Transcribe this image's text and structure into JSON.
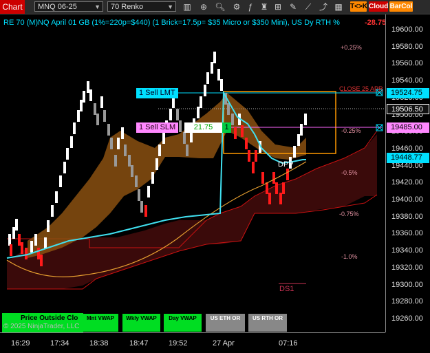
{
  "toolbar": {
    "chart_label": "Chart",
    "instrument": "MNQ 06-25",
    "bartype": "70 Renko",
    "tk_label": "T<>K",
    "cloud_label": "Cloud",
    "barcol_label": "BarCol"
  },
  "chart": {
    "title": "RE 70 (M)NQ April 01 GB (1%=220p=$440) (1 Brick=17.5p= $35 Micro or $350 Mini), US Dy RTH %",
    "pnl": "-28.75",
    "close_label": "CLOSE 25 APR",
    "dpp_label": "DPP",
    "ds1_label": "DS1",
    "watermark_line1": "Price Outside Clo",
    "watermark_line2": "© 2025 NinjaTrader, LLC"
  },
  "percent_levels": [
    "+0.25%",
    "-0.25%",
    "-0.5%",
    "-0.75%",
    "-1.0%"
  ],
  "y_axis": [
    "19600.00",
    "19580.00",
    "19560.00",
    "19540.00",
    "19520.00",
    "19500.00",
    "19480.00",
    "19460.00",
    "19440.00",
    "19420.00",
    "19400.00",
    "19380.00",
    "19360.00",
    "19340.00",
    "19320.00",
    "19300.00",
    "19280.00",
    "19260.00"
  ],
  "x_axis": [
    "16:29",
    "17:34",
    "18:38",
    "18:47",
    "19:52",
    "27 Apr",
    "07:16"
  ],
  "price_tags": {
    "sell_lmt": "19524.75",
    "last": "19506.50",
    "sell_slm": "19485.00",
    "vwap": "19448.77"
  },
  "orders": {
    "sell_lmt_label": "1 Sell LMT",
    "sell_slm_label": "1 Sell SLM",
    "sell_slm_pnl": "21.75",
    "sell_slm_qty": "1"
  },
  "bottom_buttons": [
    "Mnt VWAP",
    "Wkly VWAP",
    "Day VWAP",
    "US ETH OR",
    "US RTH OR"
  ],
  "colors": {
    "accent": "#00e0ff",
    "up_brick": "#ffffff",
    "down_brick": "#ff1a1a",
    "cloud_orange": "#a0601a",
    "cloud_red": "#5a1010",
    "vwap": "#40e0f0",
    "ma": "#f0b040"
  }
}
